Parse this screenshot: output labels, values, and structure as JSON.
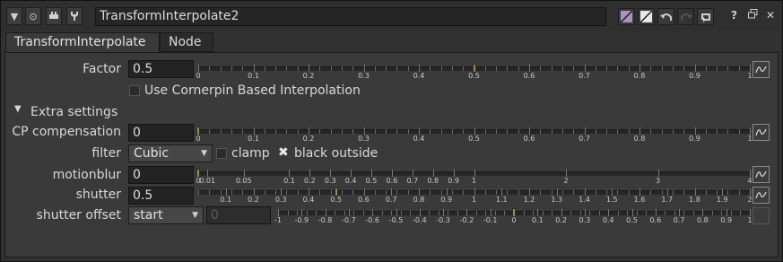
{
  "window": {
    "node_name": "TransformInterpolate2",
    "titlebar_left_icons": [
      "collapse-triangle-icon",
      "target-icon",
      "node-icon",
      "wrench-icon"
    ],
    "titlebar_right_icons": [
      "color-swatch-icon",
      "swatch-icon",
      "undo-icon",
      "redo-icon",
      "revert-icon",
      "help-icon",
      "float-icon",
      "close-icon"
    ],
    "help_label": "?",
    "close_label": "✕"
  },
  "tabs": [
    {
      "label": "TransformInterpolate",
      "active": true
    },
    {
      "label": "Node",
      "active": false
    }
  ],
  "knobs": {
    "factor": {
      "label": "Factor",
      "value": "0.5",
      "slider_ticks": [
        "0",
        "0.1",
        "0.2",
        "0.3",
        "0.4",
        "0.5",
        "0.6",
        "0.7",
        "0.8",
        "0.9",
        "1"
      ],
      "slider_value": 0.5
    },
    "use_cornerpin": {
      "label": "Use Cornerpin Based Interpolation",
      "checked": false
    },
    "extra_settings": {
      "label": "Extra settings",
      "expanded": true
    },
    "cp_compensation": {
      "label": "CP compensation",
      "value": "0",
      "slider_ticks": [
        "0",
        "0.1",
        "0.2",
        "0.3",
        "0.4",
        "0.5",
        "0.6",
        "0.7",
        "0.8",
        "0.9",
        "1"
      ],
      "slider_value": 0
    },
    "filter": {
      "label": "filter",
      "value": "Cubic"
    },
    "clamp": {
      "label": "clamp",
      "checked": false
    },
    "black_outside": {
      "label": "black outside",
      "checked": true
    },
    "motionblur": {
      "label": "motionblur",
      "value": "0",
      "slider_ticks": [
        "0",
        "0.01",
        "0.05",
        "0.1",
        "0.2",
        "0.3",
        "0.4",
        "0.5",
        "0.6",
        "0.7",
        "0.8",
        "0.9",
        "1",
        "2",
        "3",
        "4"
      ],
      "slider_value": 0
    },
    "shutter": {
      "label": "shutter",
      "value": "0.5",
      "slider_ticks": [
        "0.1",
        "0.2",
        "0.3",
        "0.4",
        "0.5",
        "0.6",
        "0.7",
        "0.8",
        "0.9",
        "1",
        "1.1",
        "1.2",
        "1.3",
        "1.4",
        "1.5",
        "1.6",
        "1.7",
        "1.8",
        "1.9",
        "2"
      ],
      "slider_value": 0.5
    },
    "shutter_offset": {
      "label": "shutter offset",
      "value": "start",
      "custom_value": "0",
      "slider_ticks": [
        "-1",
        "-0.9",
        "-0.8",
        "-0.7",
        "-0.6",
        "-0.5",
        "-0.4",
        "-0.3",
        "-0.2",
        "-0.1",
        "0",
        "0.1",
        "0.2",
        "0.3",
        "0.4",
        "0.5",
        "0.6",
        "0.7",
        "0.8",
        "0.9",
        "1"
      ],
      "slider_value": 0
    }
  },
  "colors": {
    "panel_bg": "#3a3a3a",
    "handle": "#a08850",
    "swatch_purple": "#b08ec0"
  }
}
